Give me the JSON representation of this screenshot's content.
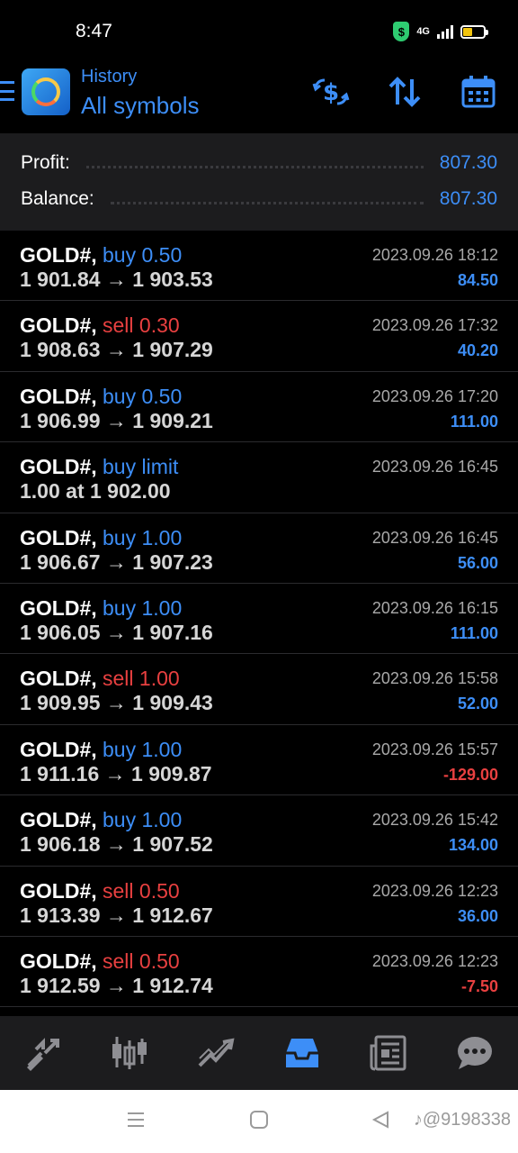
{
  "status_bar": {
    "time": "8:47",
    "network": "4G"
  },
  "header": {
    "subtitle": "History",
    "title": "All symbols",
    "actions": [
      "dollar-exchange-icon",
      "sort-icon",
      "calendar-icon"
    ]
  },
  "summary": {
    "profit_label": "Profit:",
    "profit_value": "807.30",
    "balance_label": "Balance:",
    "balance_value": "807.30"
  },
  "deals": [
    {
      "symbol": "GOLD#,",
      "type": "buy 0.50",
      "side": "buy",
      "prices": "1 901.84 → 1 903.53",
      "time": "2023.09.26 18:12",
      "profit": "84.50",
      "profit_sign": "pos"
    },
    {
      "symbol": "GOLD#,",
      "type": "sell 0.30",
      "side": "sell",
      "prices": "1 908.63 → 1 907.29",
      "time": "2023.09.26 17:32",
      "profit": "40.20",
      "profit_sign": "pos"
    },
    {
      "symbol": "GOLD#,",
      "type": "buy 0.50",
      "side": "buy",
      "prices": "1 906.99 → 1 909.21",
      "time": "2023.09.26 17:20",
      "profit": "111.00",
      "profit_sign": "pos"
    },
    {
      "symbol": "GOLD#,",
      "type": "buy limit",
      "side": "buy",
      "prices": "1.00 at 1 902.00",
      "time": "2023.09.26 16:45",
      "profit": "",
      "profit_sign": "pos"
    },
    {
      "symbol": "GOLD#,",
      "type": "buy 1.00",
      "side": "buy",
      "prices": "1 906.67 → 1 907.23",
      "time": "2023.09.26 16:45",
      "profit": "56.00",
      "profit_sign": "pos"
    },
    {
      "symbol": "GOLD#,",
      "type": "buy 1.00",
      "side": "buy",
      "prices": "1 906.05 → 1 907.16",
      "time": "2023.09.26 16:15",
      "profit": "111.00",
      "profit_sign": "pos"
    },
    {
      "symbol": "GOLD#,",
      "type": "sell 1.00",
      "side": "sell",
      "prices": "1 909.95 → 1 909.43",
      "time": "2023.09.26 15:58",
      "profit": "52.00",
      "profit_sign": "pos"
    },
    {
      "symbol": "GOLD#,",
      "type": "buy 1.00",
      "side": "buy",
      "prices": "1 911.16 → 1 909.87",
      "time": "2023.09.26 15:57",
      "profit": "-129.00",
      "profit_sign": "neg"
    },
    {
      "symbol": "GOLD#,",
      "type": "buy 1.00",
      "side": "buy",
      "prices": "1 906.18 → 1 907.52",
      "time": "2023.09.26 15:42",
      "profit": "134.00",
      "profit_sign": "pos"
    },
    {
      "symbol": "GOLD#,",
      "type": "sell 0.50",
      "side": "sell",
      "prices": "1 913.39 → 1 912.67",
      "time": "2023.09.26 12:23",
      "profit": "36.00",
      "profit_sign": "pos"
    },
    {
      "symbol": "GOLD#,",
      "type": "sell 0.50",
      "side": "sell",
      "prices": "1 912.59 → 1 912.74",
      "time": "2023.09.26 12:23",
      "profit": "-7.50",
      "profit_sign": "neg"
    }
  ],
  "tab_bar": {
    "tabs": [
      "quotes-icon",
      "chart-icon",
      "trade-icon",
      "history-icon",
      "news-icon",
      "chat-icon"
    ],
    "active": "history-icon"
  },
  "watermark": "@9198338",
  "colors": {
    "accent": "#3d8ef7",
    "sell": "#e84040",
    "background": "#000000",
    "panel": "#1c1c1e"
  }
}
